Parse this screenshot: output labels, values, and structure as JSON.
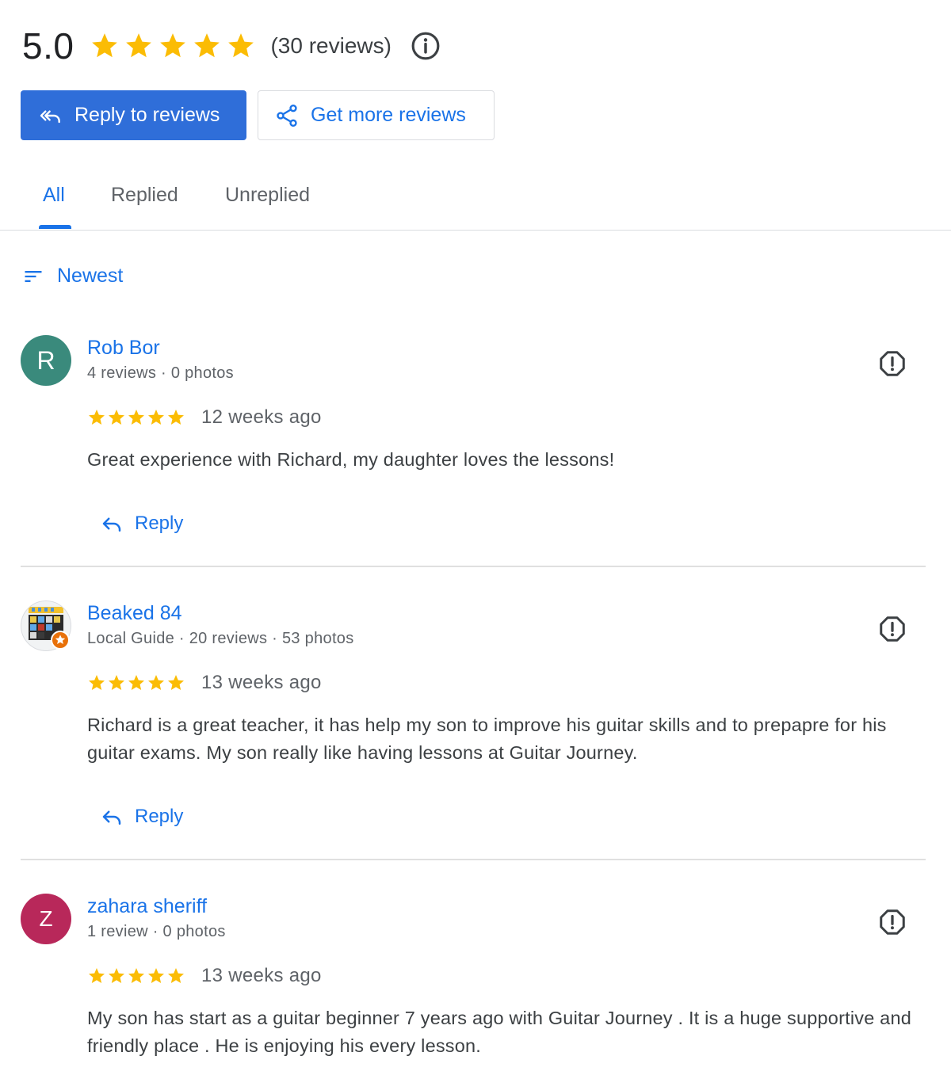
{
  "summary": {
    "rating": "5.0",
    "rating_value": 5,
    "review_count": "(30 reviews)",
    "star_color": "#fbbc04",
    "info_icon": "info-icon"
  },
  "actions": {
    "reply_to_reviews": "Reply to reviews",
    "get_more_reviews": "Get more reviews",
    "primary_color": "#2f6ed9"
  },
  "tabs": [
    {
      "label": "All",
      "selected": true
    },
    {
      "label": "Replied",
      "selected": false
    },
    {
      "label": "Unreplied",
      "selected": false
    }
  ],
  "sort": {
    "label": "Newest",
    "icon": "sort-icon"
  },
  "reviews": [
    {
      "avatar_letter": "R",
      "avatar_color": "#3a8a7c",
      "name": "Rob Bor",
      "meta": "4 reviews · 0 photos",
      "stars": 5,
      "time": "12 weeks ago",
      "text": "Great experience with Richard, my daughter loves the lessons!",
      "reply_label": "Reply"
    },
    {
      "avatar_letter": "",
      "avatar_color": "",
      "name": "Beaked 84",
      "meta": "Local Guide · 20 reviews · 53 photos",
      "stars": 5,
      "time": "13 weeks ago",
      "text": "Richard is a great teacher, it has help my son to improve his guitar skills and to prepapre for his guitar exams. My son really like having lessons at Guitar Journey.",
      "reply_label": "Reply"
    },
    {
      "avatar_letter": "Z",
      "avatar_color": "#b8285a",
      "name": "zahara sheriff",
      "meta": "1 review · 0 photos",
      "stars": 5,
      "time": "13 weeks ago",
      "text": "My son has start as a guitar beginner 7 years ago with Guitar Journey . It is a huge supportive and friendly place . He is enjoying his every lesson.",
      "reply_label": ""
    }
  ]
}
